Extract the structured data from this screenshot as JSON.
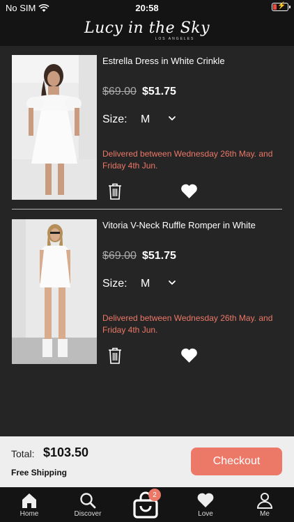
{
  "status_bar": {
    "carrier": "No SIM",
    "time": "20:58"
  },
  "header": {
    "logo": "Lucy in the Sky",
    "logo_sub": "LOS ANGELES"
  },
  "items": [
    {
      "title": "Estrella Dress in White Crinkle",
      "price_old": "$69.00",
      "price_new": "$51.75",
      "size_label": "Size:",
      "size_value": "M",
      "delivery": "Delivered between Wednesday 26th May. and Friday 4th Jun."
    },
    {
      "title": "Vitoria V-Neck Ruffle Romper in White",
      "price_old": "$69.00",
      "price_new": "$51.75",
      "size_label": "Size:",
      "size_value": "M",
      "delivery": "Delivered between Wednesday 26th May. and Friday 4th Jun."
    }
  ],
  "checkout": {
    "total_label": "Total:",
    "total_value": "$103.50",
    "shipping": "Free Shipping",
    "button": "Checkout"
  },
  "tabs": [
    {
      "label": "Home",
      "icon": "home-icon"
    },
    {
      "label": "Discover",
      "icon": "search-icon"
    },
    {
      "label": "",
      "icon": "bag-icon",
      "badge": "2"
    },
    {
      "label": "Love",
      "icon": "heart-icon"
    },
    {
      "label": "Me",
      "icon": "user-icon"
    }
  ],
  "colors": {
    "accent": "#ec7868",
    "background": "#252525",
    "bar": "#141414"
  }
}
